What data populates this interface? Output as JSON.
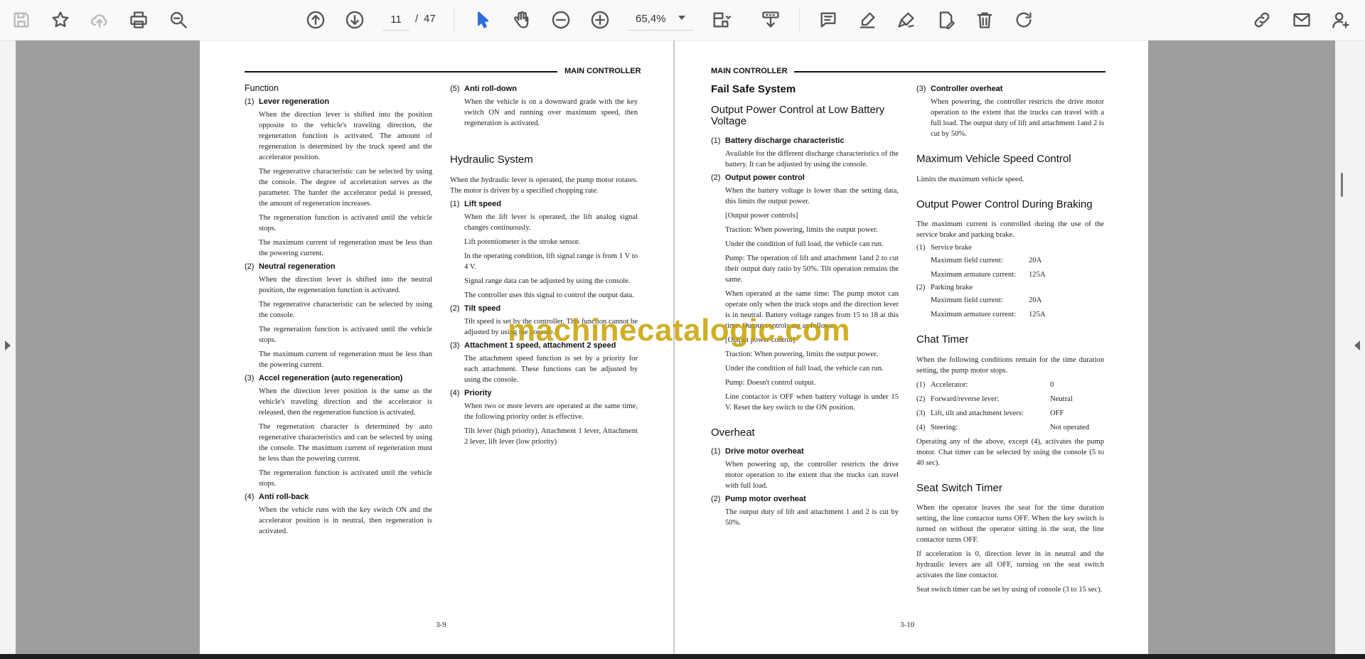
{
  "toolbar": {
    "current_page": "11",
    "page_separator": "/",
    "total_pages": "47",
    "zoom": "65,4%"
  },
  "page_left": {
    "header": "MAIN CONTROLLER",
    "page_number": "3-9",
    "col1": {
      "title": "Function",
      "i1_num": "(1)",
      "i1_title": "Lever regeneration",
      "i1_p1": "When the direction lever is shifted into the position opposite to the vehicle's traveling direction, the regeneration function is activated. The amount of regeneration is determined by the truck speed and the accelerator position.",
      "i1_p2": "The regenerative characteristic can be selected by using the console. The degree of acceleration serves as the parameter. The harder the accelerator pedal is pressed, the amount of regeneration increases.",
      "i1_p3": "The regeneration function is activated until the vehicle stops.",
      "i1_p4": "The maximum current of regeneration must be less than the powering current.",
      "i2_num": "(2)",
      "i2_title": "Neutral regeneration",
      "i2_p1": "When the direction lever is shifted into the neutral position, the regeneration function is activated.",
      "i2_p2": "The regenerative characteristic can be selected by using the console.",
      "i2_p3": "The regeneration function is activated until the vehicle stops.",
      "i2_p4": "The maximum current of regeneration must be less than the powering current.",
      "i3_num": "(3)",
      "i3_title": "Accel regeneration (auto regeneration)",
      "i3_p1": "When the direction lever position is the same as the vehicle's traveling direction and the accelerator is released, then the regeneration function is activated.",
      "i3_p2": "The regeneration character is determined by auto regenerative characteristics and can be selected by using the console. The maximum current of regeneration must be less than the powering current.",
      "i3_p3": "The regeneration function is activated until the vehicle stops.",
      "i4_num": "(4)",
      "i4_title": "Anti roll-back",
      "i4_p1": "When the vehicle runs with the key switch ON and the accelerator position is in neutral, then regeneration is activated."
    },
    "col2": {
      "i5_num": "(5)",
      "i5_title": "Anti roll-down",
      "i5_p1": "When the vehicle is on a downward grade with the key switch ON and running over maximum speed, then regeneration is activated.",
      "hyd_title": "Hydraulic System",
      "hyd_p1": "When the hydraulic lever is operated, the pump motor rotates. The motor is driven by a specified chopping rate.",
      "h1_num": "(1)",
      "h1_title": "Lift speed",
      "h1_p1": "When the lift lever is operated, the lift analog signal changes continuously.",
      "h1_p2": "Lift potentiometer is the stroke sensor.",
      "h1_p3": "In the operating condition, lift signal range is from 1 V to 4 V.",
      "h1_p4": "Signal range data can be adjusted by using the console.",
      "h1_p5": "The controller uses this signal to control the output data.",
      "h2_num": "(2)",
      "h2_title": "Tilt speed",
      "h2_p1": "Tilt speed is set by the controller. This function cannot be adjusted by using the console.",
      "h3_num": "(3)",
      "h3_title": "Attachment 1 speed, attachment 2 speed",
      "h3_p1": "The attachment speed function is set by a priority for each attachment. These functions can be adjusted by using the console.",
      "h4_num": "(4)",
      "h4_title": "Priority",
      "h4_p1": "When two or more levers are operated at the same time, the following priority order is effective.",
      "h4_p2": "Tilt lever (high priority), Attachment 1 lever, Attachment 2 lever, lift lever (low priority)"
    }
  },
  "page_right": {
    "header": "MAIN CONTROLLER",
    "page_number": "3-10",
    "col1": {
      "title": "Fail Safe System",
      "sub_title": "Output Power Control at Low Battery Voltage",
      "b1_num": "(1)",
      "b1_title": "Battery discharge characteristic",
      "b1_p1": "Available for the different discharge characteristics of the battery. It can be adjusted by using the console.",
      "b2_num": "(2)",
      "b2_title": "Output power control",
      "b2_p1": "When the battery voltage is lower than the setting data, this limits the output power.",
      "b2_p2": "[Output power controls]",
      "b2_p3": "Traction: When powering, limits the output power.",
      "b2_p4": "Under the condition of full load, the vehicle can run.",
      "b2_p5": "Pump: The operation of lift and attachment 1and 2 to cut their output duty ratio by 50%. Tilt operation remains the same.",
      "b2_p6": "When operated at the same time: The pump motor can operate only when the truck stops and the direction lever is in neutral. Battery voltage ranges from 15 to 18 at this time. Output controls are as follows.",
      "b2_p7": "[Output power control]",
      "b2_p8": "Traction: When powering, limits the output power.",
      "b2_p9": "Under the condition of full load, the vehicle can run.",
      "b2_p10": "Pump: Doesn't control output.",
      "b2_p11": "Line contactor is OFF when battery voltage is under 15 V. Reset the key switch to the ON position.",
      "over_title": "Overheat",
      "o1_num": "(1)",
      "o1_title": "Drive motor overheat",
      "o1_p1": "When powering up, the controller restricts the drive motor operation to the extent that the trucks can travel with full load.",
      "o2_num": "(2)",
      "o2_title": "Pump motor overheat",
      "o2_p1": "The output duty of lift and attachment 1 and 2 is cut by 50%."
    },
    "col2": {
      "o3_num": "(3)",
      "o3_title": "Controller overheat",
      "o3_p1": "When powering, the controller restricts the drive motor operation to the extent that the trucks can travel with a full load. The output duty of lift and attachment 1and 2 is cut by 50%.",
      "mvs_title": "Maximum Vehicle Speed Control",
      "mvs_p1": "Limits the maximum vehicle speed.",
      "opb_title": "Output Power Control During Braking",
      "opb_p1": "The maximum current is controlled during the use of the service brake and parking brake.",
      "s1_num": "(1)",
      "s1_title": "Service brake",
      "s1_k1": "Maximum field current:",
      "s1_v1": "20A",
      "s1_k2": "Maximum armature current:",
      "s1_v2": "125A",
      "s2_num": "(2)",
      "s2_title": "Parking brake",
      "s2_k1": "Maximum field current:",
      "s2_v1": "20A",
      "s2_k2": "Maximum armature current:",
      "s2_v2": "125A",
      "chat_title": "Chat Timer",
      "chat_p1": "When the following conditions remain for the time duration setting, the pump motor stops.",
      "c1_num": "(1)",
      "c1_k": "Accelerator:",
      "c1_v": "0",
      "c2_num": "(2)",
      "c2_k": "Forward/reverse lever:",
      "c2_v": "Neutral",
      "c3_num": "(3)",
      "c3_k": "Lift, tilt and attachment levers:",
      "c3_v": "OFF",
      "c4_num": "(4)",
      "c4_k": "Steering:",
      "c4_v": "Not operated",
      "chat_p2": "Operating any of the above, except (4), activates the pump motor. Chat timer can be selected by using the console (5 to 40 sec).",
      "seat_title": "Seat Switch Timer",
      "seat_p1": "When the operator leaves the seat for the time duration setting, the line contactor turns OFF. When the key switch is turned on without the operator sitting in the seat, the line contactor turns OFF.",
      "seat_p2": "If acceleration is 0, direction lever in in neutral and the hydraulic levers are all OFF, turning on the seat switch activates the line contactor.",
      "seat_p3": "Seat switch timer can be set by using of console (3 to 15 sec)."
    }
  },
  "watermark": "machinecatalogic.com",
  "icons": {
    "toolbar": [
      "save-icon",
      "bookmark-star-icon",
      "upload-cloud-icon",
      "print-icon",
      "zoom-search-icon",
      "page-up-icon",
      "page-down-icon",
      "select-pointer-icon",
      "hand-pan-icon",
      "zoom-out-icon",
      "zoom-in-icon",
      "fit-page-icon",
      "tools-icon",
      "comment-icon",
      "highlight-pen-icon",
      "sign-icon",
      "edit-pdf-icon",
      "delete-icon",
      "rotate-icon",
      "share-link-icon",
      "email-icon",
      "add-user-icon"
    ]
  }
}
